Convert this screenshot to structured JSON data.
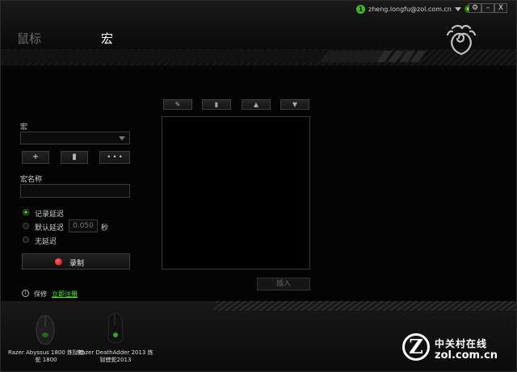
{
  "window": {
    "user_email": "zheng.longfu@zol.com.cn",
    "user_badge": "1",
    "controls": {
      "settings": "⚙",
      "minimize": "–",
      "close": "X"
    }
  },
  "tabs": [
    {
      "label": "鼠标",
      "active": false
    },
    {
      "label": "宏",
      "active": true
    }
  ],
  "macro_panel": {
    "section_label": "宏",
    "macro_select_value": "",
    "add_button": "+",
    "delete_button": "▮",
    "more_button": "• • •",
    "name_label": "宏名称",
    "name_value": "",
    "delay_options": [
      {
        "label": "记录延迟",
        "selected": true
      },
      {
        "label": "默认延迟",
        "selected": false
      },
      {
        "label": "无延迟",
        "selected": false
      }
    ],
    "default_delay_value": "0.050",
    "delay_unit": "秒",
    "record_button": "录制"
  },
  "editor": {
    "toolbar": [
      "✎",
      "▮",
      "▲",
      "▼"
    ],
    "insert_button": "插入"
  },
  "footer_links": {
    "keep": "保修",
    "register": "立即注册"
  },
  "devices": [
    {
      "name": "Razer Abyssus 1800 炼狱蝰蛇 1800"
    },
    {
      "name": "Razer DeathAdder 2013 炼狱蝰蛇2013"
    }
  ],
  "watermark": {
    "brand_cn": "中关村在线",
    "site": "zol.com.cn",
    "letter": "Z"
  },
  "colors": {
    "accent": "#44ff22",
    "record": "#d40000"
  }
}
